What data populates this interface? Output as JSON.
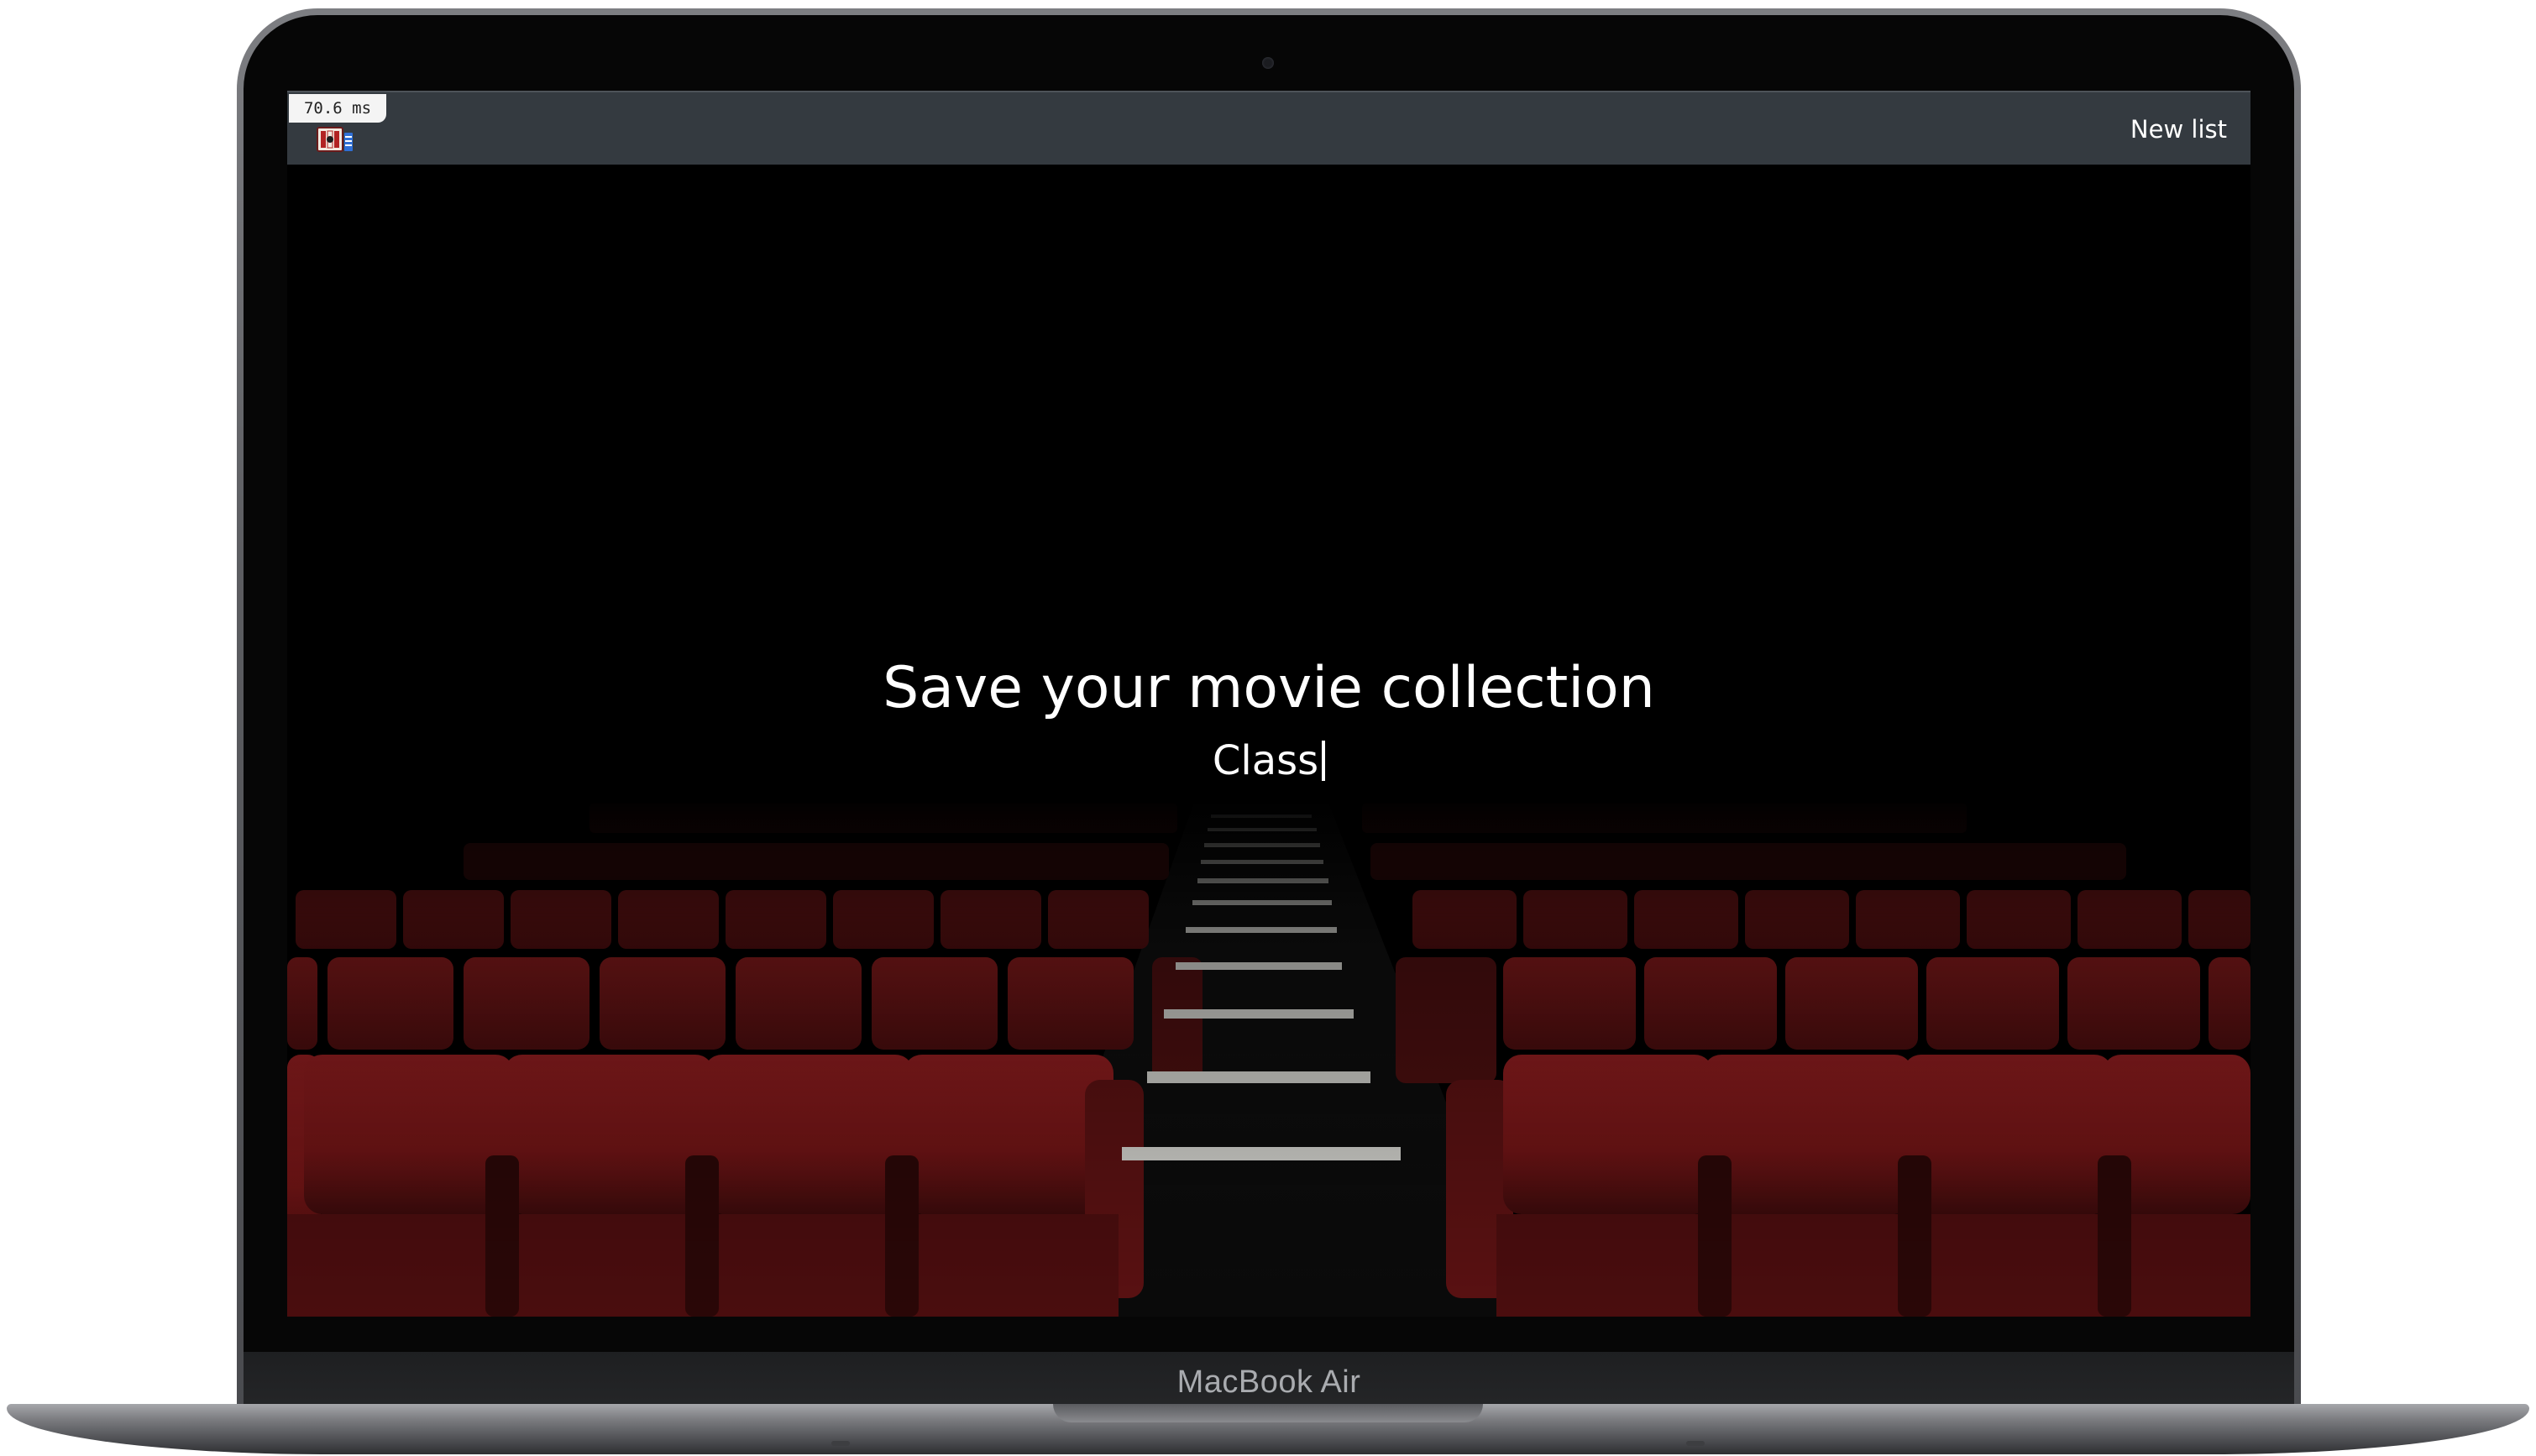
{
  "device": {
    "label": "MacBook Air"
  },
  "navbar": {
    "perf_badge": "70.6 ms",
    "new_list_label": "New list",
    "logo_icon": "film-logo-icon"
  },
  "hero": {
    "title": "Save your movie collection",
    "typed_text": "Class"
  },
  "colors": {
    "navbar_bg": "#343a40",
    "seat_red": "#7a1414",
    "screen_bg": "#000000"
  }
}
